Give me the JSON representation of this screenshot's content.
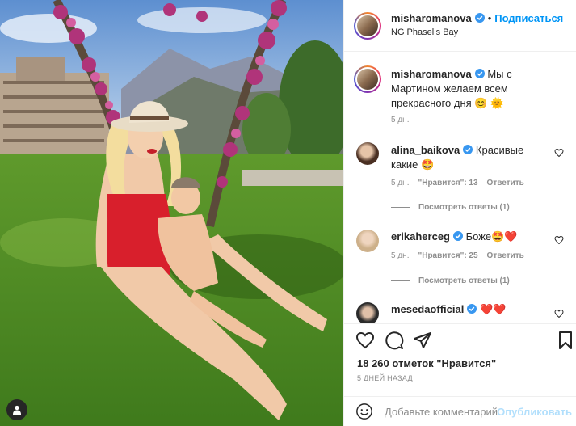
{
  "post": {
    "username": "misharomanova",
    "follow_label": "Подписаться",
    "location": "NG Phaselis Bay",
    "dot": "•"
  },
  "caption": {
    "username": "misharomanova",
    "text": "Мы с Мартином желаем всем прекрасного дня 😊 🌞",
    "time": "5 дн."
  },
  "comments": [
    {
      "username": "alina_baikova",
      "text": "Красивые какие 🤩",
      "time": "5 дн.",
      "likes": "\"Нравится\": 13",
      "reply": "Ответить",
      "view_replies": "Посмотреть ответы (1)"
    },
    {
      "username": "erikaherceg",
      "text": "Боже🤩❤️",
      "time": "5 дн.",
      "likes": "\"Нравится\": 25",
      "reply": "Ответить",
      "view_replies": "Посмотреть ответы (1)"
    },
    {
      "username": "mesedaofficial",
      "text": "❤️❤️"
    }
  ],
  "stats": {
    "likes": "18 260 отметок \"Нравится\"",
    "date": "5 ДНЕЙ НАЗАД"
  },
  "composer": {
    "placeholder": "Добавьте комментарий...",
    "post_label": "Опубликовать"
  },
  "icons": {
    "verified": "verified-badge-icon",
    "like": "heart-icon",
    "comment": "comment-icon",
    "share": "paper-plane-icon",
    "save": "bookmark-icon",
    "emoji": "smiley-icon",
    "user_tags": "user-icon"
  },
  "colors": {
    "accent": "#0095f6",
    "post_disabled": "#b2dffc",
    "verified": "#3897f0"
  }
}
